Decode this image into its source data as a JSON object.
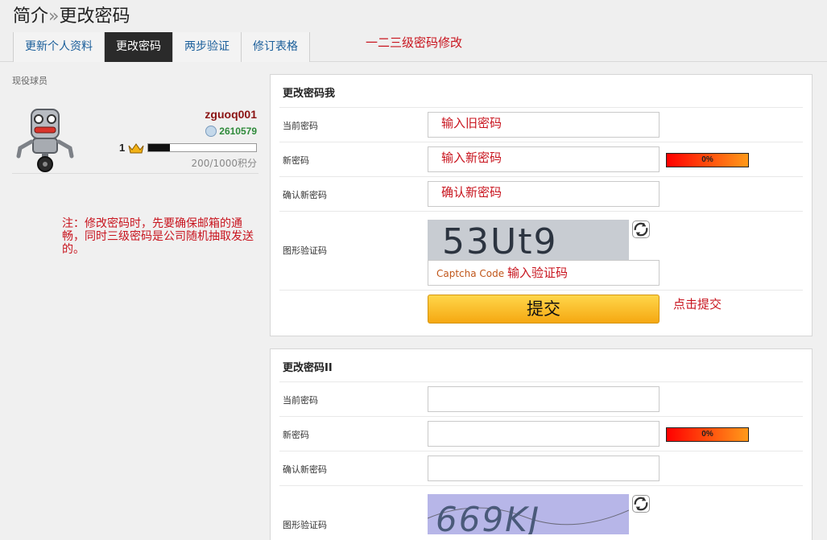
{
  "header": {
    "title": "简介",
    "title_sep": "»",
    "title_current": "更改密码",
    "tabs": [
      {
        "label": "更新个人资料"
      },
      {
        "label": "更改密码"
      },
      {
        "label": "两步验证"
      },
      {
        "label": "修订表格"
      }
    ],
    "active_tab": 1,
    "annotation": "一二三级密码修改"
  },
  "profile": {
    "role": "现役球员",
    "username": "zguoq001",
    "points": "2610579",
    "level": "1",
    "level_progress": 0.2,
    "score_text": "200/1000积分",
    "annotation": "注：修改密码时，先要确保邮箱的通畅，同时三级密码是公司随机抽取发送的。"
  },
  "panel1": {
    "title": "更改密码我",
    "current_label": "当前密码",
    "current_value": "输入旧密码",
    "new_label": "新密码",
    "new_value": "输入新密码",
    "strength": "0%",
    "confirm_label": "确认新密码",
    "confirm_value": "确认新密码",
    "captcha_label": "图形验证码",
    "captcha_text": "53Ut9",
    "captcha_placeholder": "Captcha Code",
    "captcha_hint": "输入验证码",
    "submit_label": "提交",
    "submit_annotation": "点击提交"
  },
  "panel2": {
    "title": "更改密码II",
    "current_label": "当前密码",
    "new_label": "新密码",
    "strength": "0%",
    "confirm_label": "确认新密码",
    "captcha_label": "图形验证码",
    "captcha_text": "669KJ"
  },
  "colors": {
    "annotation": "#c8141e",
    "active_tab": "#2a2a2a",
    "username": "#8b1414",
    "points": "#2e8a3a",
    "button": "#f5a812"
  }
}
